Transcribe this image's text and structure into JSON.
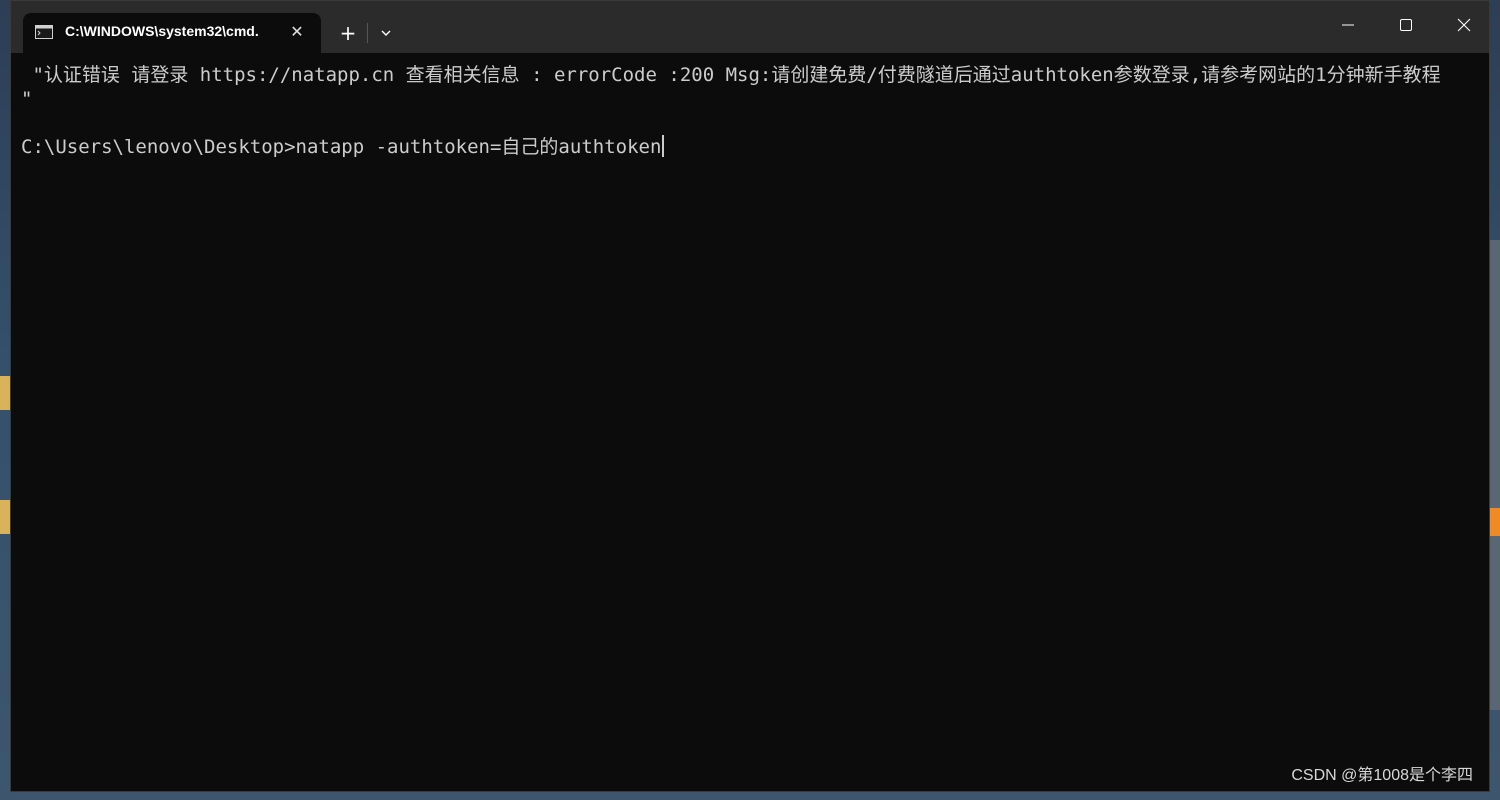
{
  "window": {
    "tab_title": "C:\\WINDOWS\\system32\\cmd.",
    "tab_icon": "console-icon",
    "close_tab_symbol": "✕",
    "new_tab_symbol": "+",
    "controls": [
      "minimize-icon",
      "maximize-icon",
      "close-icon"
    ]
  },
  "terminal": {
    "lines": [
      " \"认证错误 请登录 https://natapp.cn 查看相关信息 : errorCode :200 Msg:请创建免费/付费隧道后通过authtoken参数登录,请参考网站的1分钟新手教程    \"",
      "",
      "C:\\Users\\lenovo\\Desktop>natapp -authtoken=自己的authtoken"
    ]
  },
  "watermark": "CSDN @第1008是个李四",
  "colors": {
    "terminal_bg": "#0c0c0c",
    "titlebar_bg": "#2b2b2b",
    "text": "#cccccc"
  }
}
